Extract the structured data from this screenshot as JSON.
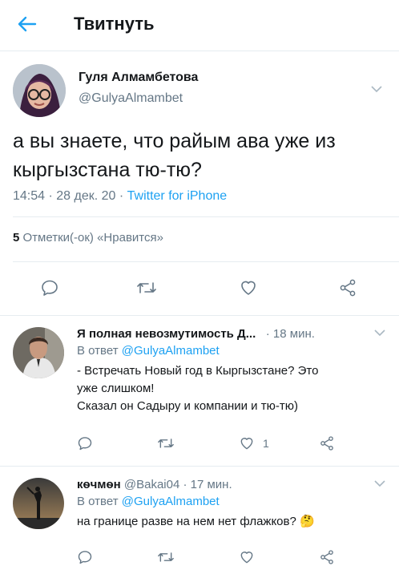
{
  "header": {
    "back_icon": "arrow-left-icon",
    "title": "Твитнуть"
  },
  "tweet": {
    "author_name": "Гуля Алмамбетова",
    "handle": "@GulyaAlmambet",
    "text": "а вы знаете, что райым ава уже из кыргызстана тю-тю?",
    "time": "14:54 · 28 дек. 20 · ",
    "source": "Twitter for iPhone",
    "likes_count": "5",
    "likes_label": "Отметки(-ок) «Нравится»"
  },
  "replies": [
    {
      "name": "Я полная невозмутимость Д...",
      "time": "· 18 мин.",
      "reply_to_label": "В ответ ",
      "reply_to_handle": "@GulyaAlmambet",
      "text_lines": [
        "- Встречать Новый год в Кыргызстане? Это",
        "уже слишком!",
        "Сказал он Садыру и компании и тю-тю)"
      ],
      "like_count": "1"
    },
    {
      "name": "кѳчмѳн",
      "handle_time": " @Bakai04 · 17 мин.",
      "reply_to_label": "В ответ ",
      "reply_to_handle": "@GulyaAlmambet",
      "text": "на границе разве на нем нет флажков? 🤔"
    }
  ],
  "colors": {
    "accent": "#1da1f2",
    "secondary_text": "#657786",
    "divider": "#e6ecf0"
  }
}
